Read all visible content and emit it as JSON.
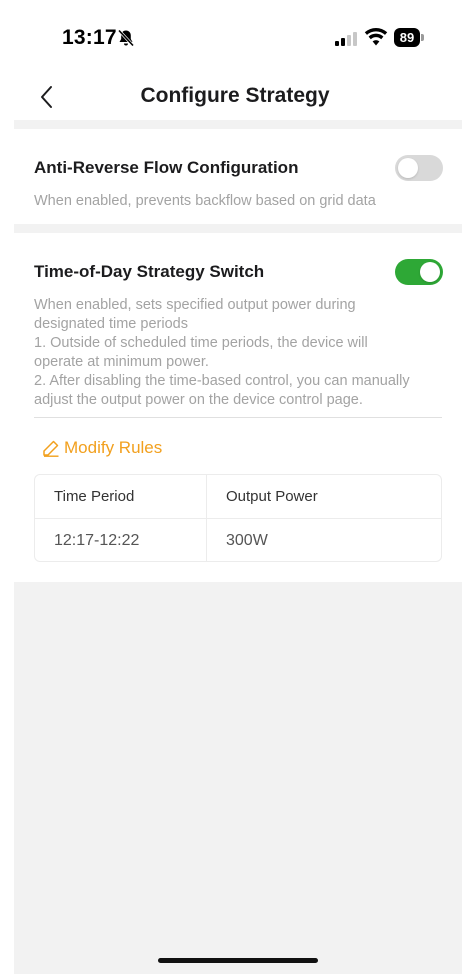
{
  "status_bar": {
    "time": "13:17",
    "battery": "89"
  },
  "nav": {
    "title": "Configure Strategy",
    "back_icon": "chevron-left-icon"
  },
  "anti_reverse": {
    "title": "Anti-Reverse Flow Configuration",
    "description": "When enabled, prevents backflow based on grid data",
    "enabled": false
  },
  "time_of_day": {
    "title": "Time-of-Day Strategy Switch",
    "description_lines": [
      "When enabled, sets specified output power during",
      "designated time periods",
      "1. Outside of scheduled time periods, the device will",
      "operate at minimum power.",
      "2. After disabling the time-based control, you can manually",
      "adjust the output power on the device control page."
    ],
    "enabled": true
  },
  "modify_rules": {
    "label": "Modify Rules",
    "icon": "pencil-icon"
  },
  "schedule": {
    "columns": [
      "Time Period",
      "Output Power"
    ],
    "rows": [
      [
        "12:17-12:22",
        "300W"
      ]
    ]
  },
  "colors": {
    "accent_orange": "#f2a01e",
    "toggle_on": "#2ea836",
    "toggle_off": "#d9d9d9",
    "band_gray": "#f2f2f2"
  }
}
